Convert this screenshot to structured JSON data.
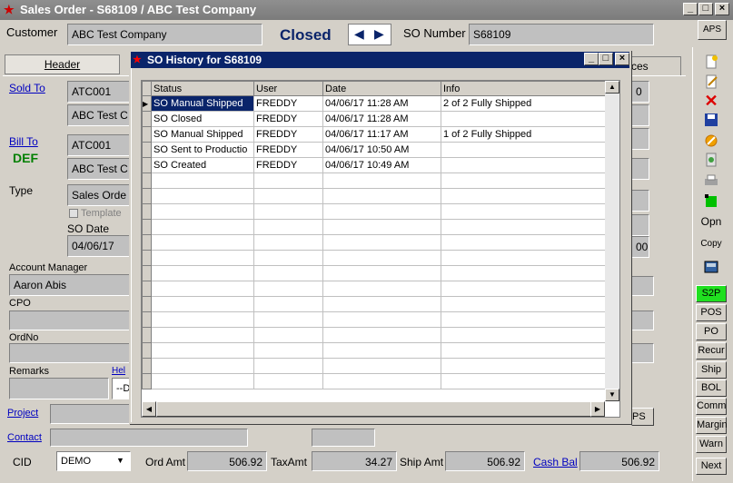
{
  "window": {
    "title": "Sales Order - S68109 / ABC Test Company"
  },
  "header": {
    "customer_label": "Customer",
    "customer_value": "ABC Test Company",
    "status": "Closed",
    "so_number_label": "SO Number",
    "so_number_value": "S68109",
    "aps_label": "APS"
  },
  "tabs": {
    "header": "Header",
    "right_partial": "ces"
  },
  "form": {
    "sold_to_label": "Sold To",
    "sold_to_code": "ATC001",
    "sold_to_name": "ABC Test C",
    "bill_to_label": "Bill To",
    "bill_to_code": "ATC001",
    "bill_to_name": "ABC Test C",
    "def_label": "DEF",
    "type_label": "Type",
    "type_value": "Sales Orde",
    "template_label": "Template",
    "so_date_label": "SO Date",
    "so_date_value": "04/06/17",
    "account_manager_label": "Account Manager",
    "account_manager_value": "Aaron Abis",
    "cpo_label": "CPO",
    "ordno_label": "OrdNo",
    "remarks_label": "Remarks",
    "help_label": "Hel",
    "remarks_value": "--D",
    "project_label": "Project",
    "contact_label": "Contact",
    "cid_label": "CID",
    "cid_value": "DEMO",
    "ord_amt_label": "Ord Amt",
    "ord_amt_value": "506.92",
    "tax_amt_label": "TaxAmt",
    "tax_amt_value": "34.27",
    "ship_amt_label": "Ship Amt",
    "ship_amt_value": "506.92",
    "cash_bal_label": "Cash Bal",
    "cash_bal_value": "506.92",
    "right_value_1": "0",
    "right_value_2": "00",
    "ps_label": "PS"
  },
  "side_buttons": [
    "Opn",
    "Copy",
    "S2P",
    "POS",
    "PO",
    "Recur",
    "Ship",
    "BOL",
    "Comm",
    "Margin",
    "Warn",
    "Next"
  ],
  "dialog": {
    "title": "SO History for S68109",
    "columns": [
      "Status",
      "User",
      "Date",
      "Info"
    ],
    "rows": [
      [
        "SO Manual Shipped",
        "FREDDY",
        "04/06/17 11:28 AM",
        "2 of 2 Fully Shipped"
      ],
      [
        "SO Closed",
        "FREDDY",
        "04/06/17 11:28 AM",
        ""
      ],
      [
        "SO Manual Shipped",
        "FREDDY",
        "04/06/17 11:17 AM",
        "1 of 2 Fully Shipped"
      ],
      [
        "SO Sent to Productio",
        "FREDDY",
        "04/06/17 10:50 AM",
        ""
      ],
      [
        "SO Created",
        "FREDDY",
        "04/06/17 10:49 AM",
        ""
      ]
    ]
  }
}
